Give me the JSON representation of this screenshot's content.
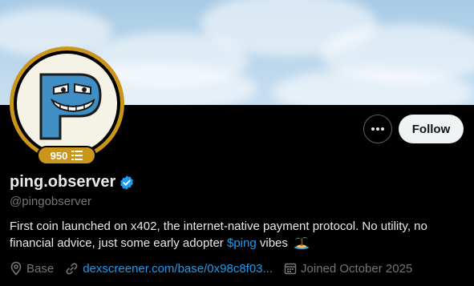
{
  "profile": {
    "display_name": "ping.observer",
    "handle": "@pingobserver",
    "verified": true,
    "badge_count": "950",
    "bio_text": "First coin launched on x402, the internet-native payment protocol. No utility, no financial advice, just some early adopter ",
    "bio_cashtag": "$ping",
    "bio_tail": " vibes",
    "location": "Base",
    "website": "dexscreener.com/base/0x98c8f03...",
    "joined": "Joined October 2025"
  },
  "actions": {
    "follow_label": "Follow"
  },
  "colors": {
    "accent": "#1d9bf0",
    "gold": "#c9961a",
    "background": "#000000",
    "secondary_text": "#71767b"
  },
  "icons": {
    "more": "more-dots-icon",
    "verified": "verified-badge-icon",
    "location": "location-pin-icon",
    "link": "link-icon",
    "calendar": "calendar-icon",
    "island": "palm-island-emoji",
    "badge": "token-stack-icon"
  }
}
